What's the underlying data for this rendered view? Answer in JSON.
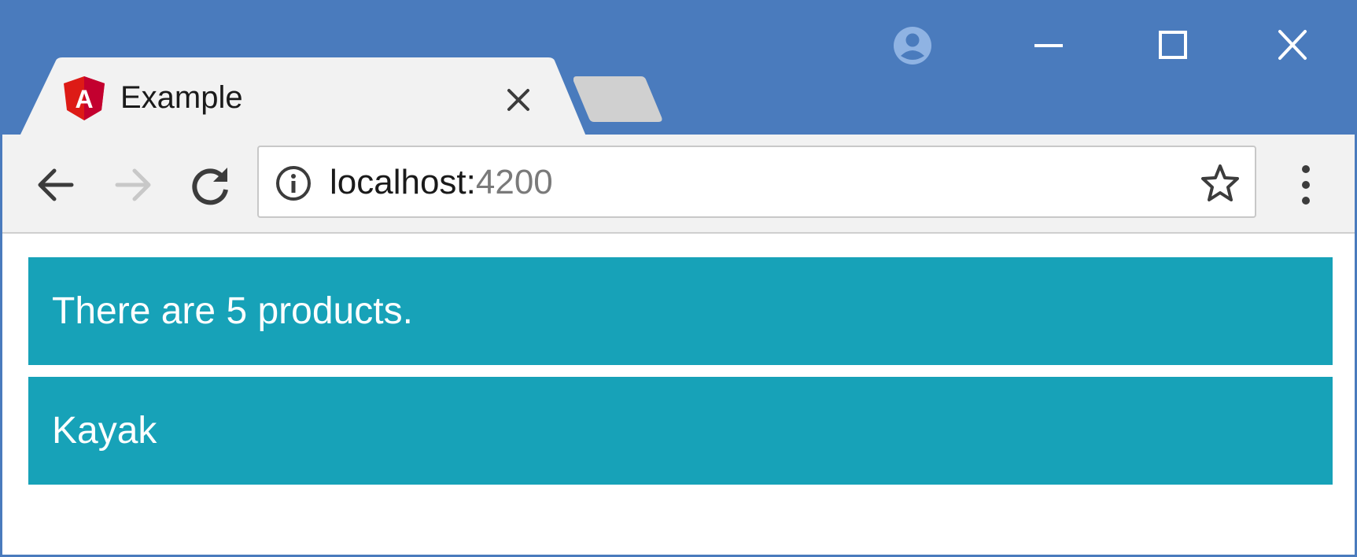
{
  "colors": {
    "titlebar": "#4a7bbd",
    "active_tab": "#f2f2f2",
    "inactive_tab": "#d0d0d0",
    "toolbar": "#f2f2f2",
    "content_bar": "#17a2b8",
    "content_text": "#ffffff",
    "favicon": "#dd1b16"
  },
  "window_controls": [
    "account-icon",
    "minimize-icon",
    "maximize-icon",
    "close-icon"
  ],
  "tab": {
    "favicon": "angular-logo",
    "title": "Example",
    "favicon_letter": "A"
  },
  "toolbar": {
    "back": "back-arrow-icon",
    "forward": "forward-arrow-icon",
    "reload": "reload-icon",
    "address": {
      "host": "localhost:",
      "port": "4200"
    },
    "bookmark": "star-icon",
    "menu": "kebab-menu-icon"
  },
  "content": {
    "summary": "There are 5 products.",
    "product": "Kayak"
  }
}
